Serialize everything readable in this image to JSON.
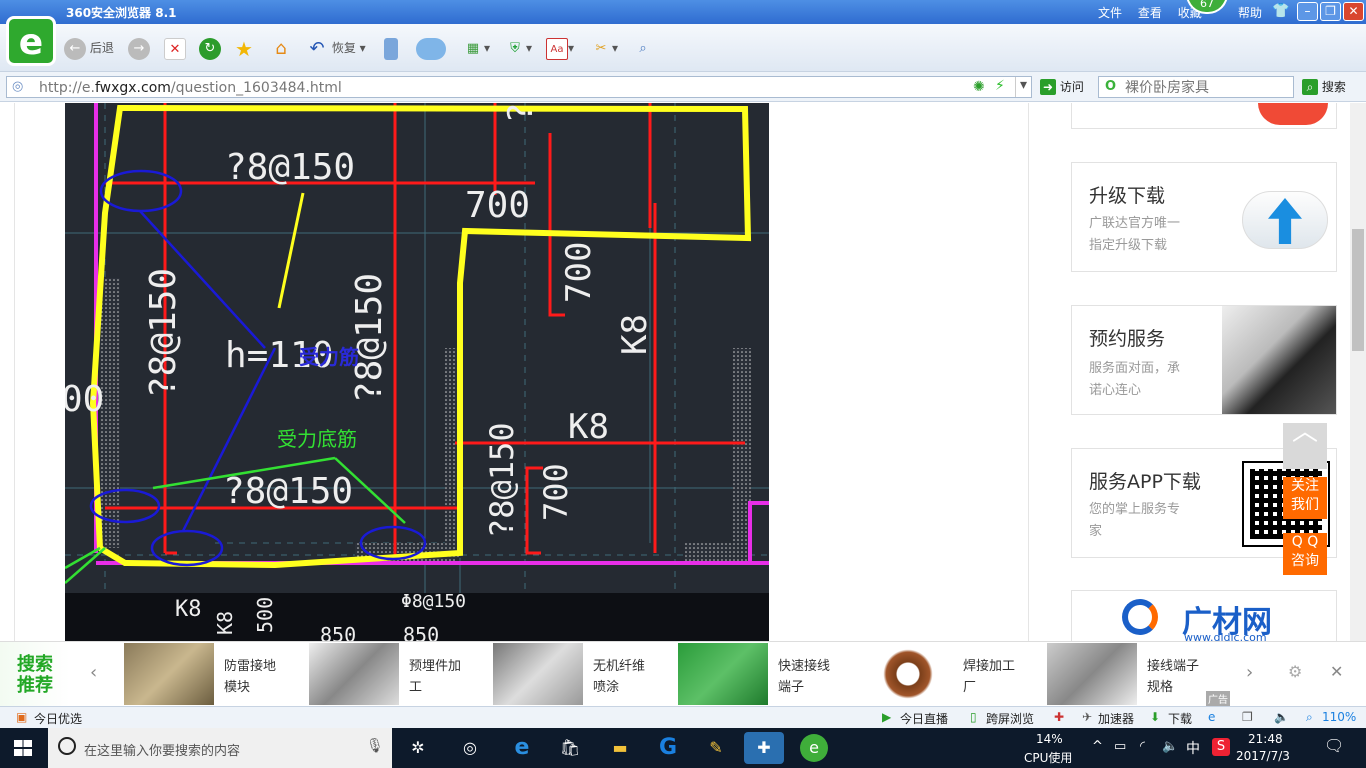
{
  "window": {
    "title": "360安全浏览器 8.1",
    "menu": [
      "文件",
      "查看",
      "收藏",
      "帮助"
    ],
    "badge": "67"
  },
  "toolbar": {
    "back": "后退",
    "restore": "恢复"
  },
  "address": {
    "url_prefix": "http://e.",
    "url_domain": "fwxgx.com",
    "url_path": "/question_1603484.html",
    "go": "访问",
    "search_placeholder": "裸价卧房家具",
    "search_btn": "搜索"
  },
  "cad": {
    "labels": [
      "?8@150",
      "700",
      "?8@",
      "?8@150",
      "h=110",
      "?8@150",
      "700",
      "K8",
      "K8",
      "?8@150",
      "?8@150",
      "700",
      "00",
      "K8",
      "500",
      "K8",
      "850",
      "850",
      "Φ8@150"
    ],
    "annot_blue": "受力筋",
    "annot_green": "受力底筋"
  },
  "sidebar": {
    "upgrade": {
      "title": "升级下载",
      "desc1": "广联达官方唯一",
      "desc2": "指定升级下载"
    },
    "booking": {
      "title": "预约服务",
      "desc1": "服务面对面，承",
      "desc2": "诺心连心"
    },
    "app": {
      "title": "服务APP下载",
      "desc1": "您的掌上服务专",
      "desc2": "家"
    },
    "brand": "广材网",
    "brand_url": "www.gldjc.com"
  },
  "floats": {
    "follow1": "关注",
    "follow2": "我们",
    "qq1": "Q Q",
    "qq2": "咨询"
  },
  "recommend": {
    "label1": "搜索",
    "label2": "推荐",
    "items": [
      {
        "l1": "防雷接地",
        "l2": "模块"
      },
      {
        "l1": "预埋件加",
        "l2": "工"
      },
      {
        "l1": "无机纤维",
        "l2": "喷涂"
      },
      {
        "l1": "快速接线",
        "l2": "端子"
      },
      {
        "l1": "焊接加工",
        "l2": "厂"
      },
      {
        "l1": "接线端子",
        "l2": "规格"
      }
    ],
    "ad": "广告"
  },
  "status": {
    "today": "今日优选",
    "live": "今日直播",
    "cross": "跨屏浏览",
    "accelerator": "加速器",
    "download": "下载",
    "zoom": "110%"
  },
  "taskbar": {
    "search_placeholder": "在这里输入你要搜索的内容",
    "cpu": "14%",
    "cpu_label": "CPU使用",
    "ime": "中",
    "time": "21:48",
    "date": "2017/7/3"
  },
  "colors": {
    "cad_bg": "#252a32",
    "yellow": "#ffff1e",
    "red": "#ff1a1a",
    "magenta": "#e82ee8",
    "blue": "#1a1ad6",
    "green": "#33e033",
    "brand_orange": "#ff6a00"
  }
}
